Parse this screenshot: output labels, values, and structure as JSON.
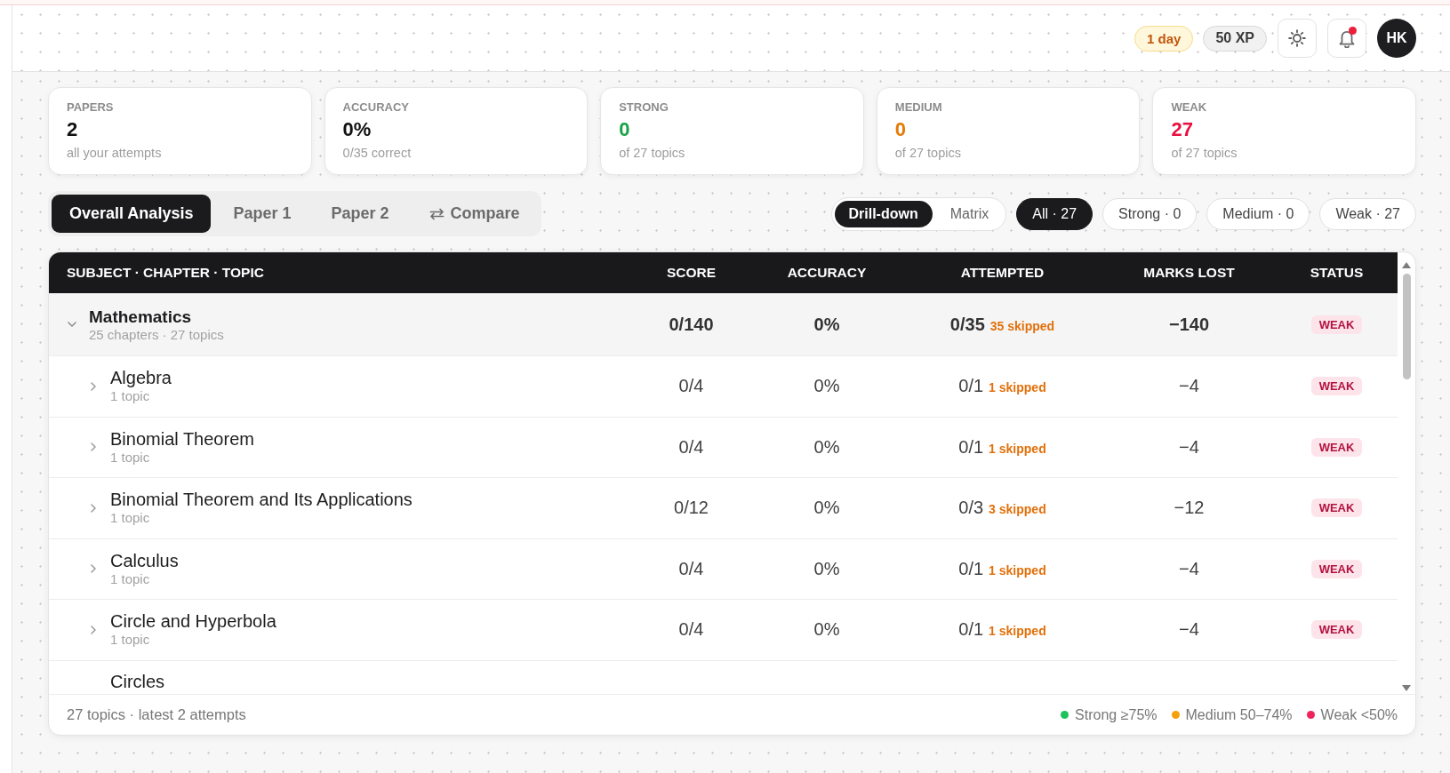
{
  "header": {
    "streak": "1 day",
    "xp": "50 XP",
    "notifications": {
      "unread": true
    },
    "avatar": "HK"
  },
  "stats": [
    {
      "label": "PAPERS",
      "value": "2",
      "note": "all your attempts",
      "color": "#111111"
    },
    {
      "label": "ACCURACY",
      "value": "0%",
      "note": "0/35 correct",
      "color": "#111111"
    },
    {
      "label": "STRONG",
      "value": "0",
      "note": "of 27 topics",
      "color": "#17a346"
    },
    {
      "label": "MEDIUM",
      "value": "0",
      "note": "of 27 topics",
      "color": "#e57b06"
    },
    {
      "label": "WEAK",
      "value": "27",
      "note": "of 27 topics",
      "color": "#e8103f"
    }
  ],
  "tabs": [
    {
      "label": "Overall Analysis",
      "selected": true,
      "kind": "plain"
    },
    {
      "label": "Paper 1",
      "selected": false,
      "kind": "plain"
    },
    {
      "label": "Paper 2",
      "selected": false,
      "kind": "plain"
    },
    {
      "label": "Compare",
      "selected": false,
      "kind": "compare"
    }
  ],
  "views": [
    {
      "label": "Drill-down",
      "selected": true
    },
    {
      "label": "Matrix",
      "selected": false
    }
  ],
  "filters": [
    {
      "label": "All · 27",
      "selected": true
    },
    {
      "label": "Strong · 0",
      "selected": false
    },
    {
      "label": "Medium · 0",
      "selected": false
    },
    {
      "label": "Weak · 27",
      "selected": false
    }
  ],
  "table": {
    "columns": [
      "SUBJECT · CHAPTER · TOPIC",
      "SCORE",
      "ACCURACY",
      "ATTEMPTED",
      "MARKS LOST",
      "STATUS"
    ],
    "rows": [
      {
        "name": "Mathematics",
        "meta": "25 chapters · 27 topics",
        "expanded": true,
        "score": "0/140",
        "accuracy": "0%",
        "attempted": "0/35",
        "skipped": "35 skipped",
        "marks_lost": "−140",
        "status": {
          "label": "WEAK",
          "kind": "weak"
        },
        "children": [
          {
            "name": "Algebra",
            "meta": "1 topic",
            "expanded": false,
            "score": "0/4",
            "accuracy": "0%",
            "attempted": "0/1",
            "skipped": "1 skipped",
            "marks_lost": "−4",
            "status": {
              "label": "WEAK",
              "kind": "weak"
            }
          },
          {
            "name": "Binomial Theorem",
            "meta": "1 topic",
            "expanded": false,
            "score": "0/4",
            "accuracy": "0%",
            "attempted": "0/1",
            "skipped": "1 skipped",
            "marks_lost": "−4",
            "status": {
              "label": "WEAK",
              "kind": "weak"
            }
          },
          {
            "name": "Binomial Theorem and Its Applications",
            "meta": "1 topic",
            "expanded": false,
            "score": "0/12",
            "accuracy": "0%",
            "attempted": "0/3",
            "skipped": "3 skipped",
            "marks_lost": "−12",
            "status": {
              "label": "WEAK",
              "kind": "weak"
            }
          },
          {
            "name": "Calculus",
            "meta": "1 topic",
            "expanded": false,
            "score": "0/4",
            "accuracy": "0%",
            "attempted": "0/1",
            "skipped": "1 skipped",
            "marks_lost": "−4",
            "status": {
              "label": "WEAK",
              "kind": "weak"
            }
          },
          {
            "name": "Circle and Hyperbola",
            "meta": "1 topic",
            "expanded": false,
            "score": "0/4",
            "accuracy": "0%",
            "attempted": "0/1",
            "skipped": "1 skipped",
            "marks_lost": "−4",
            "status": {
              "label": "WEAK",
              "kind": "weak"
            }
          },
          {
            "name": "Circles"
          }
        ]
      }
    ]
  },
  "footer": {
    "summary": "27 topics · latest 2 attempts",
    "legend": [
      {
        "label": "Strong ≥75%",
        "color": "#1ec25a"
      },
      {
        "label": "Medium 50–74%",
        "color": "#f5a00b"
      },
      {
        "label": "Weak <50%",
        "color": "#f0245a"
      }
    ]
  }
}
